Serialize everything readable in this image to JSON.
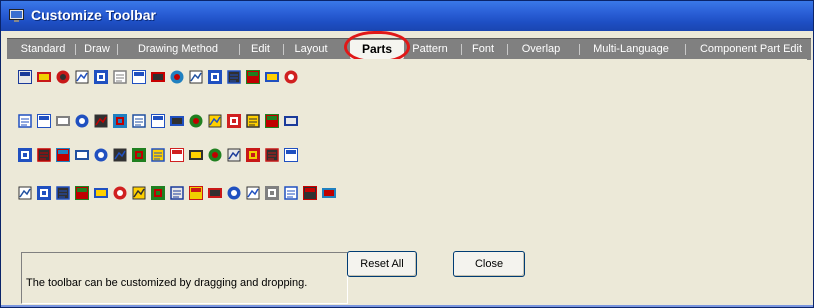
{
  "window": {
    "title": "Customize Toolbar",
    "title_icon": "monitor-icon"
  },
  "tabs": [
    {
      "label": "Standard",
      "active": false
    },
    {
      "label": "Draw",
      "active": false
    },
    {
      "label": "Drawing Method",
      "active": false
    },
    {
      "label": "Edit",
      "active": false
    },
    {
      "label": "Layout",
      "active": false
    },
    {
      "label": "Parts",
      "active": true
    },
    {
      "label": "Pattern",
      "active": false
    },
    {
      "label": "Font",
      "active": false
    },
    {
      "label": "Overlap",
      "active": false
    },
    {
      "label": "Multi-Language",
      "active": false
    },
    {
      "label": "Component Part Edit",
      "active": false
    }
  ],
  "icon_rows": [
    [
      "window-screen-icon",
      "switch-icon",
      "lamp-icon",
      "numeric-display-icon",
      "abc-display-icon",
      "message-display-icon",
      "data-table-icon",
      "bar-graph-icon",
      "pen-icon",
      "comment-icon",
      "calculator-icon",
      "keypad-icon",
      "trend-icon",
      "chart-icon",
      "pie-graph-icon"
    ],
    [
      "meter-icon",
      "pattern-icon",
      "graph-icon",
      "picture-icon",
      "animation-icon",
      "historical-trend-icon",
      "historical-data-icon",
      "line-graph-icon",
      "alarm-icon",
      "card-icon",
      "macro-icon",
      "calendar-icon",
      "frame-icon",
      "sheet-icon",
      "timer-icon"
    ],
    [
      "flask-icon",
      "bell-icon",
      "network-icon",
      "speaker-icon",
      "jpeg-icon",
      "monitor-icon",
      "video-icon",
      "tree-icon",
      "parts-icon",
      "tag-icon",
      "image-icon",
      "recipe-icon",
      "print-icon",
      "backup-icon",
      "palette-icon"
    ],
    [
      "list-icon",
      "radio-button-icon",
      "panel-icon",
      "grid-icon",
      "record-icon",
      "log-icon",
      "edit-icon",
      "view-icon",
      "window-icon",
      "folder-icon",
      "macro-folder-icon",
      "file-icon",
      "report-icon",
      "clock-icon",
      "data-icon",
      "input-icon",
      "slider-icon"
    ]
  ],
  "footer": {
    "status_text": "The toolbar can be customized by dragging and dropping.",
    "reset_label": "Reset All",
    "close_label": "Close"
  },
  "colors": {
    "titlebar": "#2a5fd6",
    "tabbar": "#808080",
    "highlight": "#e01818"
  }
}
